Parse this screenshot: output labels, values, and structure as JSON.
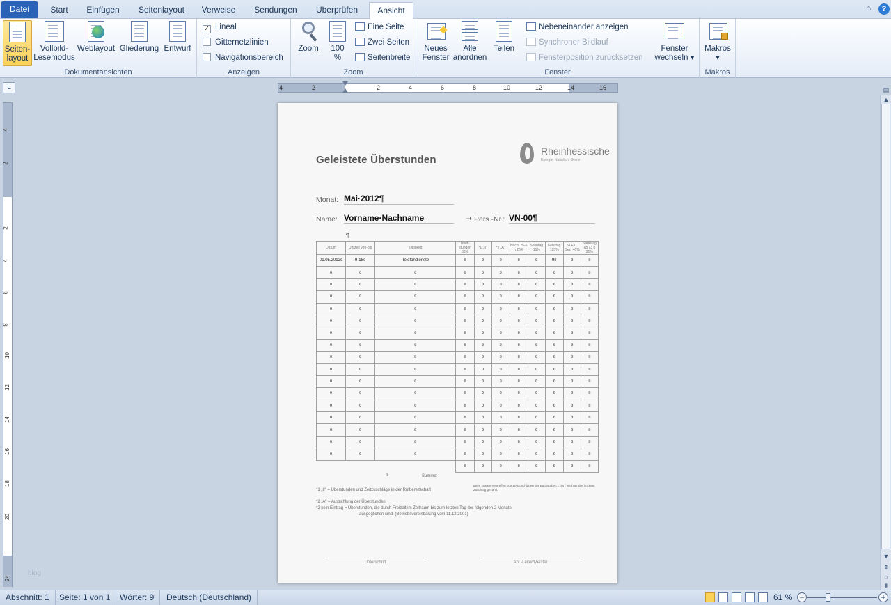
{
  "tabs": {
    "file": "Datei",
    "items": [
      "Start",
      "Einfügen",
      "Seitenlayout",
      "Verweise",
      "Sendungen",
      "Überprüfen",
      "Ansicht"
    ]
  },
  "ribbon": {
    "views": {
      "group_label": "Dokumentansichten",
      "print_layout": "Seiten-\nlayout",
      "print_layout_l1": "Seiten-",
      "print_layout_l2": "layout",
      "full_screen_l1": "Vollbild-",
      "full_screen_l2": "Lesemodus",
      "web_layout": "Weblayout",
      "outline": "Gliederung",
      "draft": "Entwurf"
    },
    "show": {
      "group_label": "Anzeigen",
      "ruler": "Lineal",
      "ruler_checked": true,
      "gridlines": "Gitternetzlinien",
      "gridlines_checked": false,
      "nav_pane": "Navigationsbereich",
      "nav_pane_checked": false
    },
    "zoom": {
      "group_label": "Zoom",
      "zoom": "Zoom",
      "hundred_l1": "100",
      "hundred_l2": "%",
      "one_page": "Eine Seite",
      "two_pages": "Zwei Seiten",
      "page_width": "Seitenbreite"
    },
    "window": {
      "group_label": "Fenster",
      "new_window_l1": "Neues",
      "new_window_l2": "Fenster",
      "arrange_all_l1": "Alle",
      "arrange_all_l2": "anordnen",
      "split": "Teilen",
      "side_by_side": "Nebeneinander anzeigen",
      "sync_scroll": "Synchroner Bildlauf",
      "reset_position": "Fensterposition zurücksetzen",
      "switch_l1": "Fenster",
      "switch_l2": "wechseln"
    },
    "macros": {
      "group_label": "Makros",
      "macros": "Makros"
    }
  },
  "ruler": {
    "h_ticks": [
      "4",
      "2",
      "2",
      "4",
      "6",
      "8",
      "10",
      "12",
      "14",
      "16"
    ],
    "v_ticks": [
      "4",
      "2",
      "2",
      "4",
      "6",
      "8",
      "10",
      "12",
      "14",
      "16",
      "18",
      "20",
      "24"
    ]
  },
  "document": {
    "title": "Geleistete Überstunden",
    "logo_name": "Rheinhessische",
    "logo_tagline": "Energie. Natürlich. Gerne",
    "month_label": "Monat:",
    "month_value": "Mai·2012¶",
    "name_label": "Name:",
    "name_value": "Vorname·Nachname",
    "persnr_label": "Pers.-Nr.:",
    "persnr_value": "VN-00¶",
    "pilcrow": "¶",
    "table_headers": [
      "Datum",
      "Uhrzeit von-bis",
      "Tätigkeit",
      "Über-stunden 30%",
      "*1 „II“",
      "*2 „A“",
      "Nacht 25-6 h 25%",
      "Sonntag 15%",
      "Feiertag 125%",
      "24.+31. Dez. 40%",
      "Samstag ab 13 h 25%"
    ],
    "first_row": [
      "01.05.2012¤",
      "9-18¤",
      "Telefondienst¤",
      "¤",
      "¤",
      "¤",
      "¤",
      "¤",
      "9¤",
      "¤",
      "¤"
    ],
    "empty_cell": "¤",
    "sum_label": "Summe:",
    "footnote1": "*1    „II“ = Überstunden und Zeitzuschläge in der Rufbereitschaft",
    "footnote1_right": "Beim Zusammentreffen von Zeitzuschlägen der Buchstaben c bis f wird nur der höchste Zuschlag gezahlt.",
    "footnote2": "*2    „A“ = Auszahlung der Überstunden",
    "footnote3a": "*2    kein Eintrag = Überstunden, die durch Freizeit im Zeitraum bis zum letzten Tag der folgenden 2 Monate",
    "footnote3b": "ausgeglichen sind. (Betriebsvereinbarung vom 11.12.2001)",
    "sig_left": "Unterschrift",
    "sig_right": "Abt.-Leiter/Meister"
  },
  "watermark": "blog",
  "status": {
    "section": "Abschnitt: 1",
    "page": "Seite: 1 von 1",
    "words": "Wörter: 9",
    "language": "Deutsch (Deutschland)",
    "zoom": "61 %",
    "zoom_level_percent": 61
  }
}
